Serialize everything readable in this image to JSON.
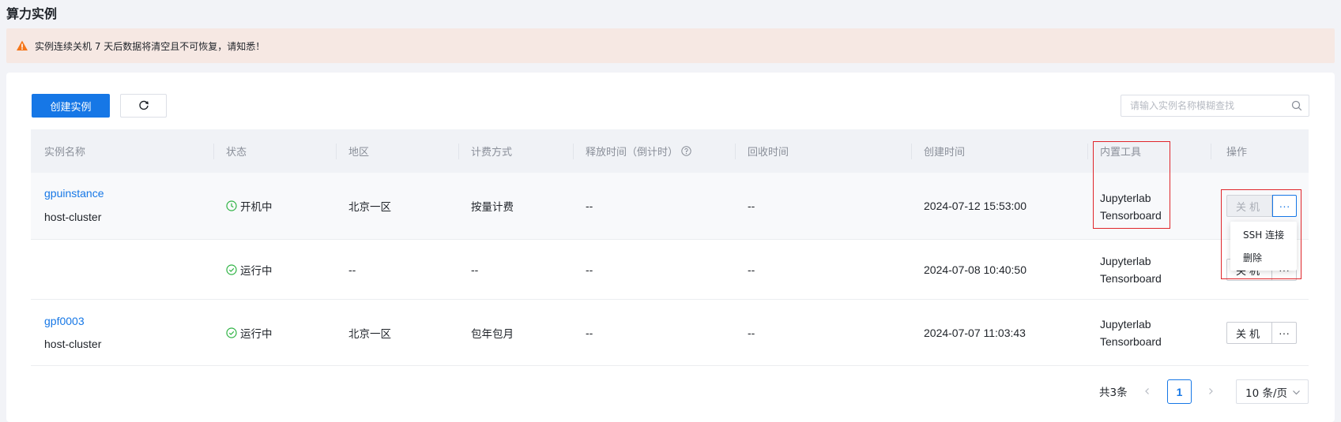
{
  "page": {
    "title": "算力实例"
  },
  "alert": {
    "text": "实例连续关机 7 天后数据将清空且不可恢复，请知悉！",
    "icon": "warning-icon",
    "color": "#f5761a"
  },
  "toolbar": {
    "create_label": "创建实例",
    "refresh_icon": "refresh-icon"
  },
  "search": {
    "placeholder": "请输入实例名称模糊查找",
    "value": ""
  },
  "table": {
    "headers": {
      "name": "实例名称",
      "status": "状态",
      "region": "地区",
      "billing": "计费方式",
      "release": "释放时间（倒计时）",
      "recycle": "回收时间",
      "created": "创建时间",
      "tools": "内置工具",
      "actions": "操作"
    },
    "rows": [
      {
        "name": "gpuinstance",
        "cluster": "host-cluster",
        "status": "开机中",
        "region": "北京一区",
        "billing": "按量计费",
        "release": "--",
        "recycle": "--",
        "created": "2024-07-12 15:53:00",
        "tools": [
          "Jupyterlab",
          "Tensorboard"
        ],
        "action_label": "关机"
      },
      {
        "name": "",
        "cluster": "",
        "status": "运行中",
        "region": "--",
        "billing": "--",
        "release": "--",
        "recycle": "--",
        "created": "2024-07-08 10:40:50",
        "tools": [
          "Jupyterlab",
          "Tensorboard"
        ],
        "action_label": "关机"
      },
      {
        "name": "gpf0003",
        "cluster": "host-cluster",
        "status": "运行中",
        "region": "北京一区",
        "billing": "包年包月",
        "release": "--",
        "recycle": "--",
        "created": "2024-07-07 11:03:43",
        "tools": [
          "Jupyterlab",
          "Tensorboard"
        ],
        "action_label": "关机"
      }
    ],
    "more_label": "···"
  },
  "dropdown": {
    "items": [
      "SSH 连接",
      "删除"
    ]
  },
  "pagination": {
    "total": "共3条",
    "current_page": "1",
    "page_size": "10 条/页"
  },
  "colors": {
    "primary": "#1677e6",
    "success": "#2fb344",
    "highlight": "#e0252a"
  }
}
